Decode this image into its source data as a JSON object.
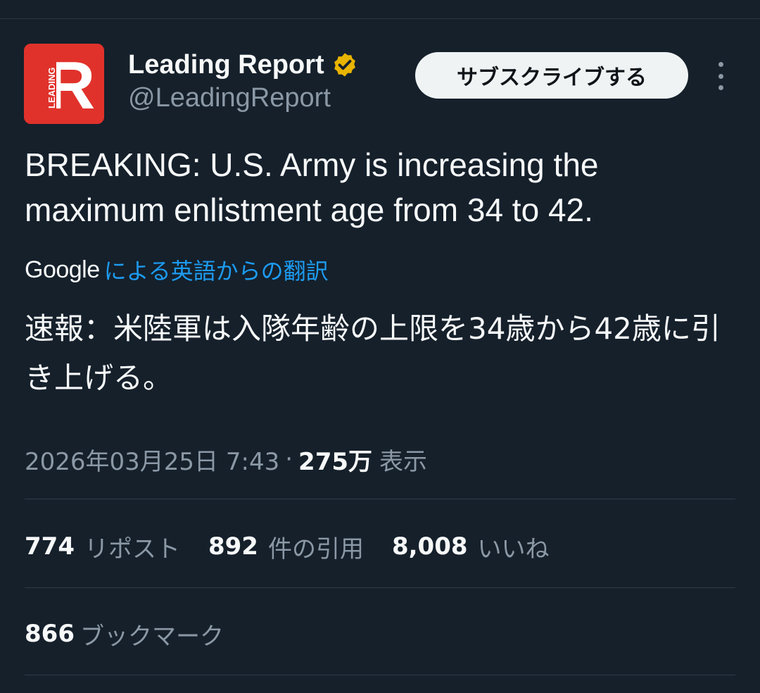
{
  "author": {
    "display_name": "Leading Report",
    "handle": "@LeadingReport",
    "avatar_letter": "R",
    "avatar_text": "LEADING",
    "avatar_color": "#e0322b",
    "verified": true,
    "verified_icon": "verified-gold-badge-icon",
    "verified_color": "#e8b400"
  },
  "subscribe_label": "サブスクライブする",
  "more_icon": "more-vertical-icon",
  "tweet_text": "BREAKING: U.S. Army is increasing the maximum enlistment age from 34 to 42.",
  "translation": {
    "provider": "Google",
    "link_text": "による英語からの翻訳",
    "text": "速報：米陸軍は入隊年齢の上限を34歳から42歳に引き上げる。"
  },
  "meta": {
    "timestamp": "2026年03月25日 7:43",
    "separator": "·",
    "views_count": "275万",
    "views_label": "表示"
  },
  "stats": {
    "reposts_count": "774",
    "reposts_label": "リポスト",
    "quotes_count": "892",
    "quotes_label": "件の引用",
    "likes_count": "8,008",
    "likes_label": "いいね",
    "bookmarks_count": "866",
    "bookmarks_label": "ブックマーク"
  },
  "colors": {
    "background": "#15202b",
    "text_primary": "#f7f9f9",
    "text_secondary": "#8b98a5",
    "link": "#1d9bf0",
    "button_bg": "#eff3f4"
  }
}
